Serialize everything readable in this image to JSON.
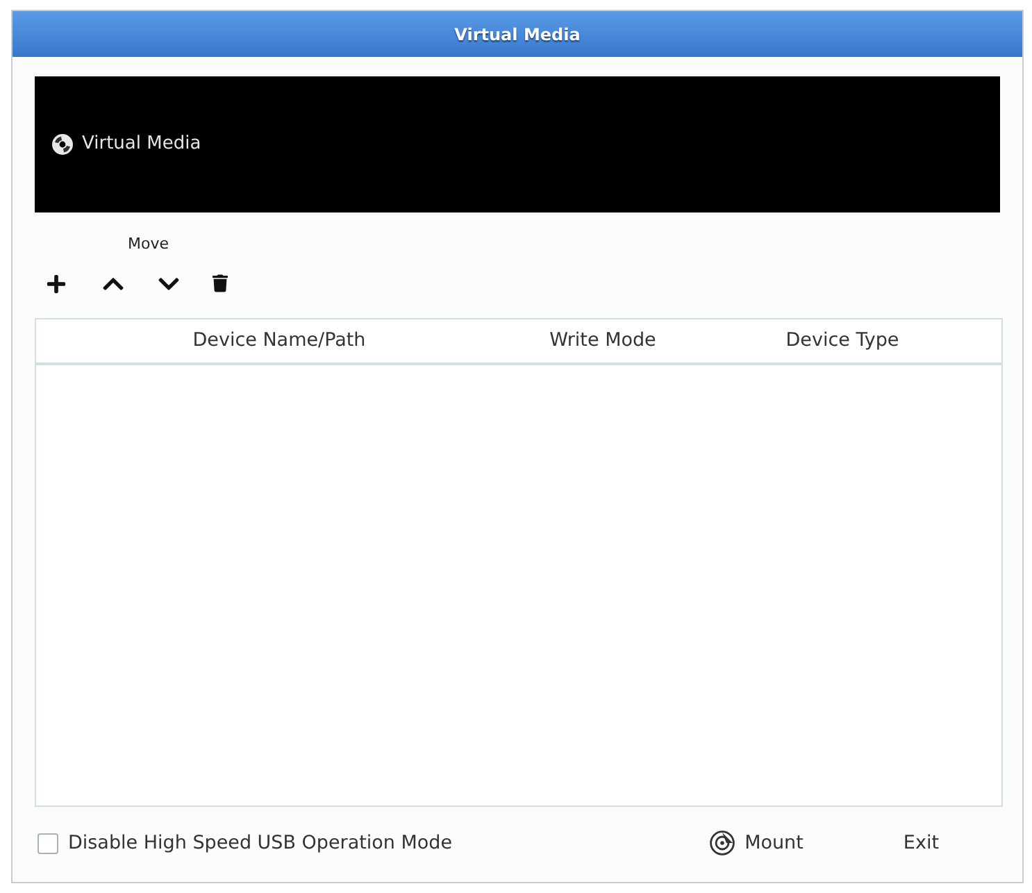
{
  "window": {
    "title": "Virtual Media"
  },
  "banner": {
    "title": "Virtual Media"
  },
  "toolbar": {
    "move_label": "Move",
    "buttons": [
      {
        "kind": "add"
      },
      {
        "kind": "up"
      },
      {
        "kind": "down"
      },
      {
        "kind": "delete"
      }
    ]
  },
  "table": {
    "columns": [
      "Device Name/Path",
      "Write Mode",
      "Device Type"
    ]
  },
  "options": [
    {
      "label": "Disable High Speed USB Operation Mode",
      "checked": false
    }
  ],
  "buttons": [
    {
      "kind": "mount",
      "label": "Mount"
    },
    {
      "kind": "exit",
      "label": "Exit"
    }
  ]
}
